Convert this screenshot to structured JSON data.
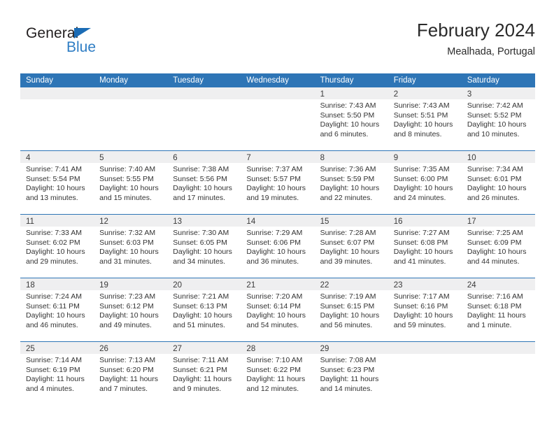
{
  "brand": {
    "name_dark": "General",
    "name_blue": "Blue",
    "accent_color": "#2e75b6"
  },
  "header": {
    "title": "February 2024",
    "subtitle": "Mealhada, Portugal"
  },
  "calendar": {
    "weekday_headers": [
      "Sunday",
      "Monday",
      "Tuesday",
      "Wednesday",
      "Thursday",
      "Friday",
      "Saturday"
    ],
    "header_bg": "#2e75b6",
    "daynum_band_bg": "#efeff0",
    "weeks": [
      [
        {
          "day": "",
          "lines": []
        },
        {
          "day": "",
          "lines": []
        },
        {
          "day": "",
          "lines": []
        },
        {
          "day": "",
          "lines": []
        },
        {
          "day": "1",
          "lines": [
            "Sunrise: 7:43 AM",
            "Sunset: 5:50 PM",
            "Daylight: 10 hours",
            "and 6 minutes."
          ]
        },
        {
          "day": "2",
          "lines": [
            "Sunrise: 7:43 AM",
            "Sunset: 5:51 PM",
            "Daylight: 10 hours",
            "and 8 minutes."
          ]
        },
        {
          "day": "3",
          "lines": [
            "Sunrise: 7:42 AM",
            "Sunset: 5:52 PM",
            "Daylight: 10 hours",
            "and 10 minutes."
          ]
        }
      ],
      [
        {
          "day": "4",
          "lines": [
            "Sunrise: 7:41 AM",
            "Sunset: 5:54 PM",
            "Daylight: 10 hours",
            "and 13 minutes."
          ]
        },
        {
          "day": "5",
          "lines": [
            "Sunrise: 7:40 AM",
            "Sunset: 5:55 PM",
            "Daylight: 10 hours",
            "and 15 minutes."
          ]
        },
        {
          "day": "6",
          "lines": [
            "Sunrise: 7:38 AM",
            "Sunset: 5:56 PM",
            "Daylight: 10 hours",
            "and 17 minutes."
          ]
        },
        {
          "day": "7",
          "lines": [
            "Sunrise: 7:37 AM",
            "Sunset: 5:57 PM",
            "Daylight: 10 hours",
            "and 19 minutes."
          ]
        },
        {
          "day": "8",
          "lines": [
            "Sunrise: 7:36 AM",
            "Sunset: 5:59 PM",
            "Daylight: 10 hours",
            "and 22 minutes."
          ]
        },
        {
          "day": "9",
          "lines": [
            "Sunrise: 7:35 AM",
            "Sunset: 6:00 PM",
            "Daylight: 10 hours",
            "and 24 minutes."
          ]
        },
        {
          "day": "10",
          "lines": [
            "Sunrise: 7:34 AM",
            "Sunset: 6:01 PM",
            "Daylight: 10 hours",
            "and 26 minutes."
          ]
        }
      ],
      [
        {
          "day": "11",
          "lines": [
            "Sunrise: 7:33 AM",
            "Sunset: 6:02 PM",
            "Daylight: 10 hours",
            "and 29 minutes."
          ]
        },
        {
          "day": "12",
          "lines": [
            "Sunrise: 7:32 AM",
            "Sunset: 6:03 PM",
            "Daylight: 10 hours",
            "and 31 minutes."
          ]
        },
        {
          "day": "13",
          "lines": [
            "Sunrise: 7:30 AM",
            "Sunset: 6:05 PM",
            "Daylight: 10 hours",
            "and 34 minutes."
          ]
        },
        {
          "day": "14",
          "lines": [
            "Sunrise: 7:29 AM",
            "Sunset: 6:06 PM",
            "Daylight: 10 hours",
            "and 36 minutes."
          ]
        },
        {
          "day": "15",
          "lines": [
            "Sunrise: 7:28 AM",
            "Sunset: 6:07 PM",
            "Daylight: 10 hours",
            "and 39 minutes."
          ]
        },
        {
          "day": "16",
          "lines": [
            "Sunrise: 7:27 AM",
            "Sunset: 6:08 PM",
            "Daylight: 10 hours",
            "and 41 minutes."
          ]
        },
        {
          "day": "17",
          "lines": [
            "Sunrise: 7:25 AM",
            "Sunset: 6:09 PM",
            "Daylight: 10 hours",
            "and 44 minutes."
          ]
        }
      ],
      [
        {
          "day": "18",
          "lines": [
            "Sunrise: 7:24 AM",
            "Sunset: 6:11 PM",
            "Daylight: 10 hours",
            "and 46 minutes."
          ]
        },
        {
          "day": "19",
          "lines": [
            "Sunrise: 7:23 AM",
            "Sunset: 6:12 PM",
            "Daylight: 10 hours",
            "and 49 minutes."
          ]
        },
        {
          "day": "20",
          "lines": [
            "Sunrise: 7:21 AM",
            "Sunset: 6:13 PM",
            "Daylight: 10 hours",
            "and 51 minutes."
          ]
        },
        {
          "day": "21",
          "lines": [
            "Sunrise: 7:20 AM",
            "Sunset: 6:14 PM",
            "Daylight: 10 hours",
            "and 54 minutes."
          ]
        },
        {
          "day": "22",
          "lines": [
            "Sunrise: 7:19 AM",
            "Sunset: 6:15 PM",
            "Daylight: 10 hours",
            "and 56 minutes."
          ]
        },
        {
          "day": "23",
          "lines": [
            "Sunrise: 7:17 AM",
            "Sunset: 6:16 PM",
            "Daylight: 10 hours",
            "and 59 minutes."
          ]
        },
        {
          "day": "24",
          "lines": [
            "Sunrise: 7:16 AM",
            "Sunset: 6:18 PM",
            "Daylight: 11 hours",
            "and 1 minute."
          ]
        }
      ],
      [
        {
          "day": "25",
          "lines": [
            "Sunrise: 7:14 AM",
            "Sunset: 6:19 PM",
            "Daylight: 11 hours",
            "and 4 minutes."
          ]
        },
        {
          "day": "26",
          "lines": [
            "Sunrise: 7:13 AM",
            "Sunset: 6:20 PM",
            "Daylight: 11 hours",
            "and 7 minutes."
          ]
        },
        {
          "day": "27",
          "lines": [
            "Sunrise: 7:11 AM",
            "Sunset: 6:21 PM",
            "Daylight: 11 hours",
            "and 9 minutes."
          ]
        },
        {
          "day": "28",
          "lines": [
            "Sunrise: 7:10 AM",
            "Sunset: 6:22 PM",
            "Daylight: 11 hours",
            "and 12 minutes."
          ]
        },
        {
          "day": "29",
          "lines": [
            "Sunrise: 7:08 AM",
            "Sunset: 6:23 PM",
            "Daylight: 11 hours",
            "and 14 minutes."
          ]
        },
        {
          "day": "",
          "lines": []
        },
        {
          "day": "",
          "lines": []
        }
      ]
    ]
  }
}
